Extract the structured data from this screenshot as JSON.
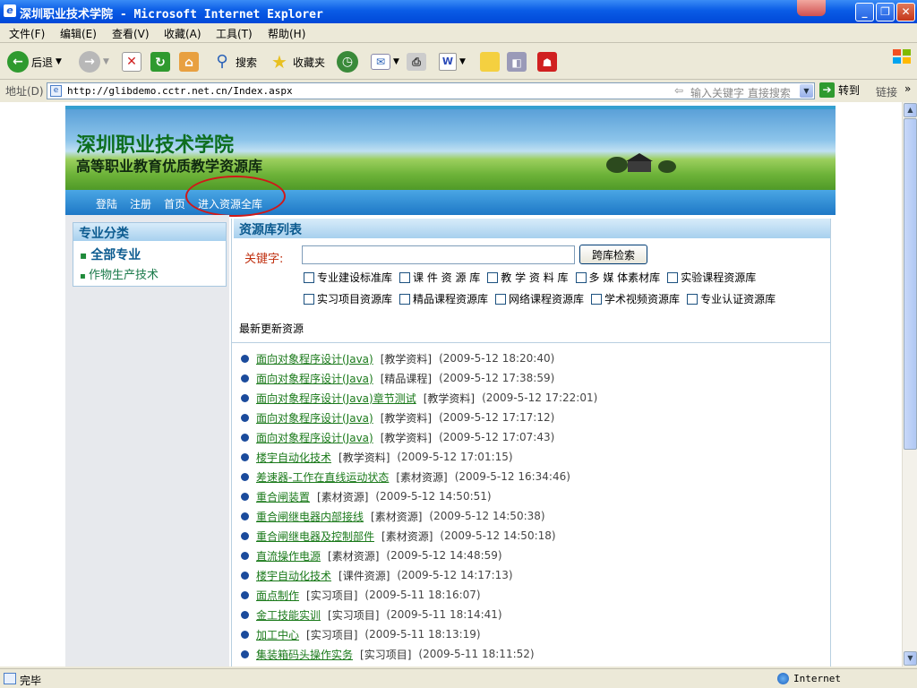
{
  "window": {
    "title": "深圳职业技术学院 - Microsoft Internet Explorer"
  },
  "menu": [
    "文件(F)",
    "编辑(E)",
    "查看(V)",
    "收藏(A)",
    "工具(T)",
    "帮助(H)"
  ],
  "toolbar": {
    "back": "后退",
    "search": "搜索",
    "favorites": "收藏夹"
  },
  "address": {
    "label": "地址(D)",
    "url": "http://glibdemo.cctr.net.cn/Index.aspx",
    "search_hint": "输入关键字 直接搜索",
    "go": "转到",
    "links": "链接"
  },
  "site": {
    "title": "深圳职业技术学院",
    "subtitle": "高等职业教育优质教学资源库",
    "nav": [
      "登陆",
      "注册",
      "首页",
      "进入资源全库"
    ],
    "sidebar": {
      "heading": "专业分类",
      "items": [
        "全部专业",
        "作物生产技术"
      ]
    },
    "main": {
      "heading": "资源库列表",
      "keyword_label": "关键字:",
      "keyword_value": "",
      "search_button": "跨库检索",
      "checkboxes_row1": [
        "专业建设标准库",
        "课 件 资 源 库",
        "教 学 资 料 库",
        "多 媒 体素材库",
        "实验课程资源库"
      ],
      "checkboxes_row2": [
        "实习项目资源库",
        "精品课程资源库",
        "网络课程资源库",
        "学术视频资源库",
        "专业认证资源库"
      ],
      "latest_label": "最新更新资源",
      "items": [
        {
          "title": "面向对象程序设计(Java)",
          "category": "[教学资料]",
          "date": "(2009-5-12 18:20:40)"
        },
        {
          "title": "面向对象程序设计(Java)",
          "category": "[精品课程]",
          "date": "(2009-5-12 17:38:59)"
        },
        {
          "title": "面向对象程序设计(Java)章节测试",
          "category": "[教学资料]",
          "date": "(2009-5-12 17:22:01)"
        },
        {
          "title": "面向对象程序设计(Java)",
          "category": "[教学资料]",
          "date": "(2009-5-12 17:17:12)"
        },
        {
          "title": "面向对象程序设计(Java)",
          "category": "[教学资料]",
          "date": "(2009-5-12 17:07:43)"
        },
        {
          "title": "楼宇自动化技术",
          "category": "[教学资料]",
          "date": "(2009-5-12 17:01:15)"
        },
        {
          "title": "差速器-工作在直线运动状态",
          "category": "[素材资源]",
          "date": "(2009-5-12 16:34:46)"
        },
        {
          "title": "重合闸装置",
          "category": "[素材资源]",
          "date": "(2009-5-12 14:50:51)"
        },
        {
          "title": "重合闸继电器内部接线",
          "category": "[素材资源]",
          "date": "(2009-5-12 14:50:38)"
        },
        {
          "title": "重合闸继电器及控制部件",
          "category": "[素材资源]",
          "date": "(2009-5-12 14:50:18)"
        },
        {
          "title": "直流操作电源",
          "category": "[素材资源]",
          "date": "(2009-5-12 14:48:59)"
        },
        {
          "title": "楼宇自动化技术",
          "category": "[课件资源]",
          "date": "(2009-5-12 14:17:13)"
        },
        {
          "title": "面点制作",
          "category": "[实习项目]",
          "date": "(2009-5-11 18:16:07)"
        },
        {
          "title": "金工技能实训",
          "category": "[实习项目]",
          "date": "(2009-5-11 18:14:41)"
        },
        {
          "title": "加工中心",
          "category": "[实习项目]",
          "date": "(2009-5-11 18:13:19)"
        },
        {
          "title": "集装箱码头操作实务",
          "category": "[实习项目]",
          "date": "(2009-5-11 18:11:52)"
        }
      ]
    }
  },
  "status": {
    "text": "完毕",
    "zone": "Internet"
  }
}
